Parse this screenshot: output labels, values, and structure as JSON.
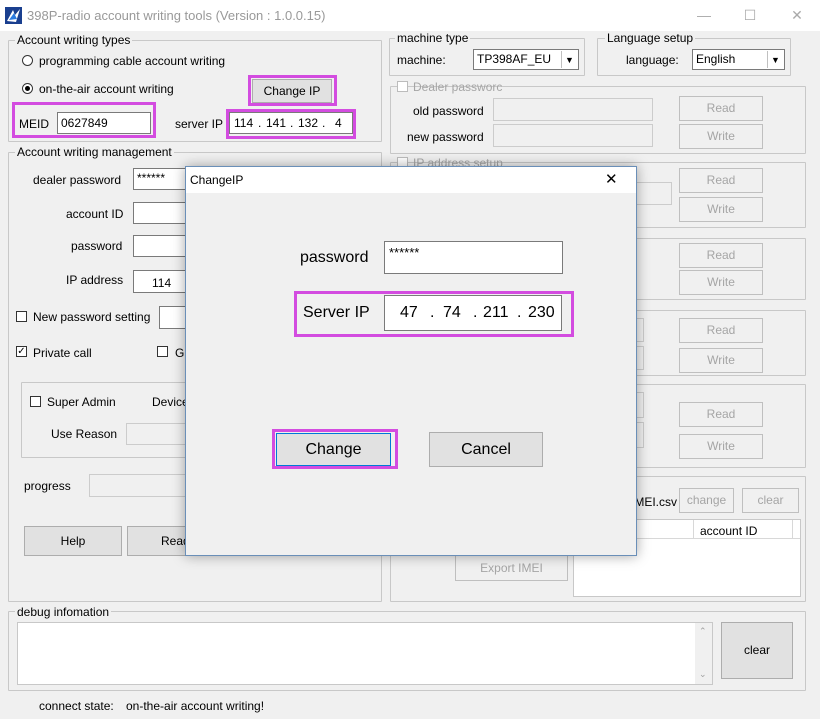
{
  "window": {
    "title": "398P-radio account writing tools (Version : 1.0.0.15)",
    "minimize": "—",
    "maximize": "☐",
    "close": "✕"
  },
  "writing_types": {
    "title": "Account writing types",
    "option_cable": "programming cable account writing",
    "option_air": "on-the-air account writing",
    "selected": "on-the-air account writing",
    "change_ip_button": "Change IP",
    "meid_label": "MEID",
    "meid_value": "0627849",
    "server_ip_label": "server IP",
    "server_ip": {
      "o1": "114",
      "o2": "141",
      "o3": "132",
      "o4": "4"
    }
  },
  "machine_type": {
    "title": "machine type",
    "label": "machine:",
    "value": "TP398AF_EU"
  },
  "language": {
    "title": "Language setup",
    "label": "language:",
    "value": "English"
  },
  "dealer_password": {
    "title": "Dealer passworc",
    "old_label": "old password",
    "new_label": "new password",
    "read": "Read",
    "write": "Write"
  },
  "ip_setup": {
    "title": "IP address setup",
    "read": "Read",
    "write": "Write"
  },
  "right_groups": {
    "read": "Read",
    "write": "Write"
  },
  "imei": {
    "csv_label": "IMEI.csv",
    "change_button": "change",
    "clear_button": "clear",
    "col_account": "account ID",
    "export_button": "Export IMEI"
  },
  "management": {
    "title": "Account writing management",
    "dealer_password_label": "dealer password",
    "dealer_password_value": "******",
    "account_id_label": "account ID",
    "password_label": "password",
    "ip_address_label": "IP address",
    "ip_first_octet": "114",
    "new_password_setting": "New password setting",
    "private_call": "Private call",
    "g_partial": "G",
    "super_admin": "Super Admin",
    "device_partial": "Device",
    "use_reason_label": "Use Reason",
    "progress_label": "progress",
    "help_button": "Help",
    "read_partial": "Read"
  },
  "debug": {
    "title": "debug infomation",
    "clear_button": "clear"
  },
  "status": {
    "label": "connect state:",
    "value": "on-the-air account writing!"
  },
  "dialog": {
    "title": "ChangeIP",
    "close": "✕",
    "password_label": "password",
    "password_value": "******",
    "server_ip_label": "Server IP",
    "server_ip": {
      "o1": "47",
      "o2": "74",
      "o3": "211",
      "o4": "230"
    },
    "change_button": "Change",
    "cancel_button": "Cancel"
  },
  "colors": {
    "highlight": "#d34ce0",
    "dialog_border": "#6a8fb8",
    "window_bg": "#f0f0f0"
  }
}
